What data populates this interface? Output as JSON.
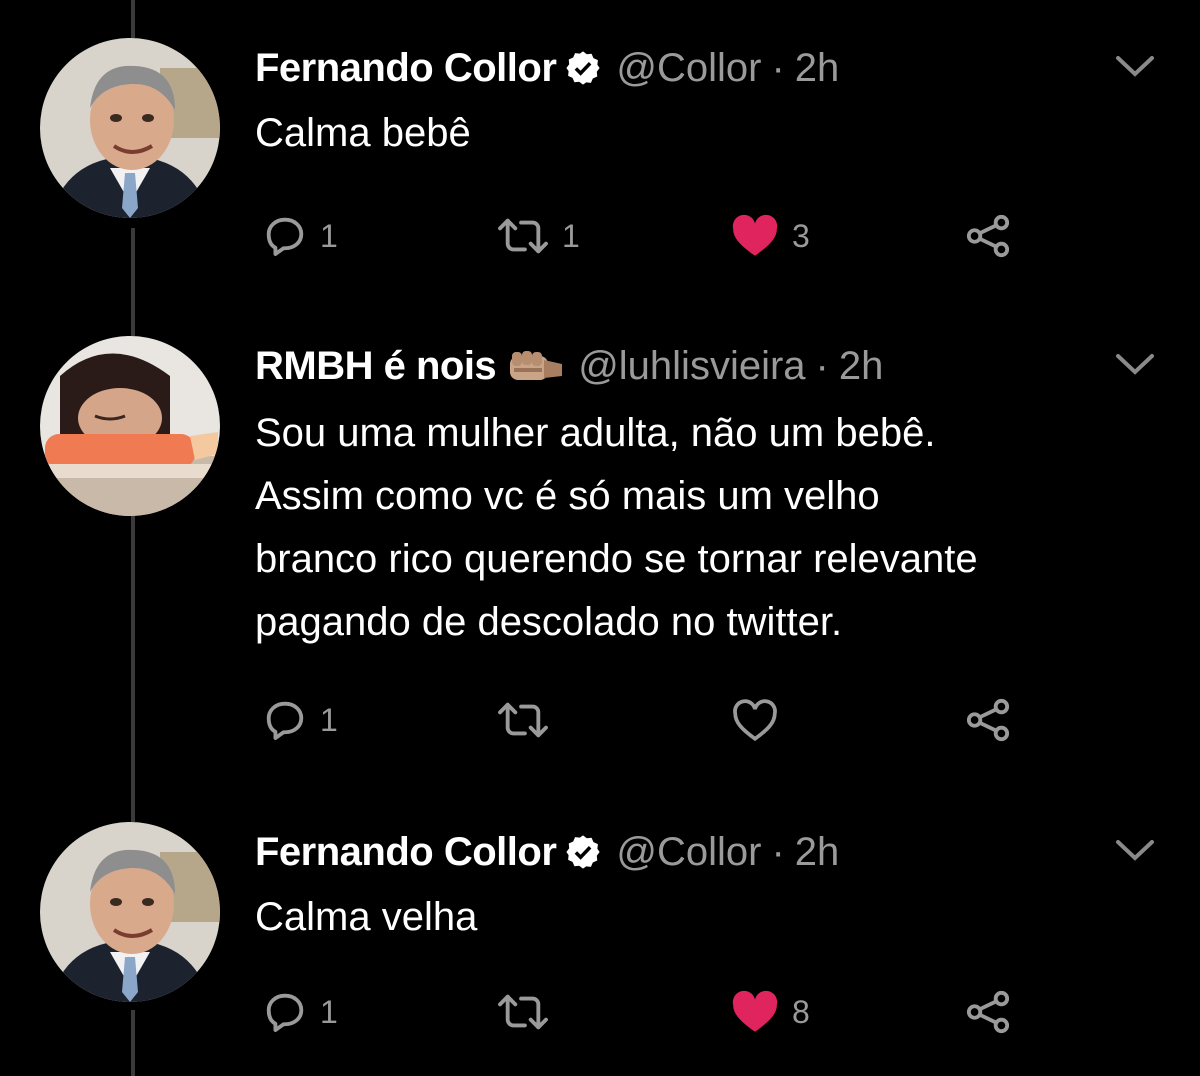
{
  "tweets": [
    {
      "author_name": "Fernando Collor",
      "verified": true,
      "handle": "@Collor",
      "separator": "·",
      "time": "2h",
      "text": "Calma bebê",
      "avatar": "avatar-fernando-collor",
      "reply_count": "1",
      "retweet_count": "1",
      "like_count": "3",
      "liked": true
    },
    {
      "author_name": "RMBH é nois",
      "name_emoji": "fist-emoji",
      "handle": "@luhlisvieira",
      "separator": "·",
      "time": "2h",
      "text": "Sou uma mulher adulta, não um bebê.\nAssim como vc é só mais um velho\nbranco rico querendo se tornar relevante\npagando de descolado no twitter.",
      "avatar": "avatar-rmbh",
      "reply_count": "1",
      "retweet_count": "",
      "like_count": "",
      "liked": false
    },
    {
      "author_name": "Fernando Collor",
      "verified": true,
      "handle": "@Collor",
      "separator": "·",
      "time": "2h",
      "text": "Calma velha",
      "avatar": "avatar-fernando-collor",
      "reply_count": "1",
      "retweet_count": "",
      "like_count": "8",
      "liked": true
    }
  ],
  "colors": {
    "background": "#000000",
    "text": "#ffffff",
    "secondary": "#9a9a9a",
    "like": "#e0245e",
    "thread_line": "#3a3a3a"
  }
}
